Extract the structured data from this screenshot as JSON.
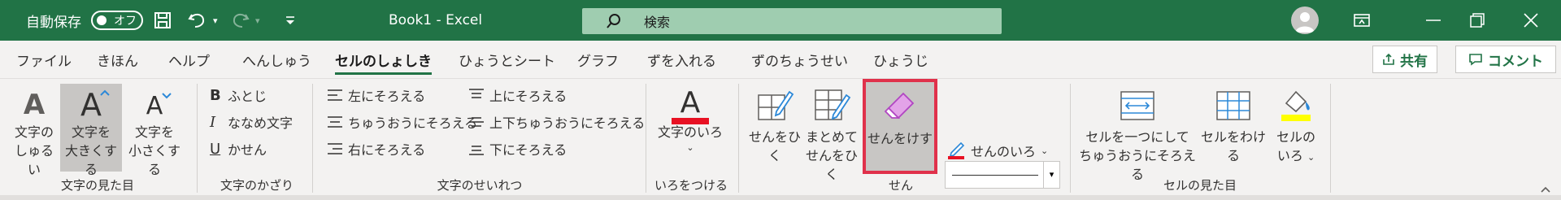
{
  "titlebar": {
    "autosave_label": "自動保存",
    "autosave_state": "オフ",
    "title": "Book1  -  Excel",
    "search_placeholder": "検索"
  },
  "tabs": [
    "ファイル",
    "きほん",
    "ヘルプ",
    "へんしゅう",
    "セルのしょしき",
    "ひょうとシート",
    "グラフ",
    "ずを入れる",
    "ずのちょうせい",
    "ひょうじ"
  ],
  "header_buttons": {
    "share": "共有",
    "comment": "コメント"
  },
  "groups": {
    "text_appearance": {
      "label": "文字の見た目",
      "font_type": [
        "文字の",
        "しゅるい"
      ],
      "enlarge": [
        "文字を",
        "大きくする"
      ],
      "shrink": [
        "文字を",
        "小さくする"
      ]
    },
    "decoration": {
      "label": "文字のかざり",
      "bold": "ふとじ",
      "italic": "ななめ文字",
      "underline": "かせん"
    },
    "alignment": {
      "label": "文字のせいれつ",
      "left": "左にそろえる",
      "center": "ちゅうおうにそろえる",
      "right": "右にそろえる",
      "top": "上にそろえる",
      "middle": "上下ちゅうおうにそろえる",
      "bottom": "下にそろえる"
    },
    "color": {
      "label": "いろをつける",
      "font_color": "文字のいろ"
    },
    "lines": {
      "label": "せん",
      "draw": "せんをひく",
      "draw_all": [
        "まとめて",
        "せんをひく"
      ],
      "erase": "せんをけす",
      "line_color": "せんのいろ"
    },
    "cell_appearance": {
      "label": "セルの見た目",
      "merge_center": [
        "セルを一つにして",
        "ちゅうおうにそろえる"
      ],
      "split": "セルをわける",
      "fill_color": [
        "セルの",
        "いろ"
      ]
    }
  },
  "colors": {
    "brand": "#217346",
    "font_color_bar": "#e81123",
    "fill_color_bar": "#ffff00",
    "highlight": "#e0314b"
  }
}
